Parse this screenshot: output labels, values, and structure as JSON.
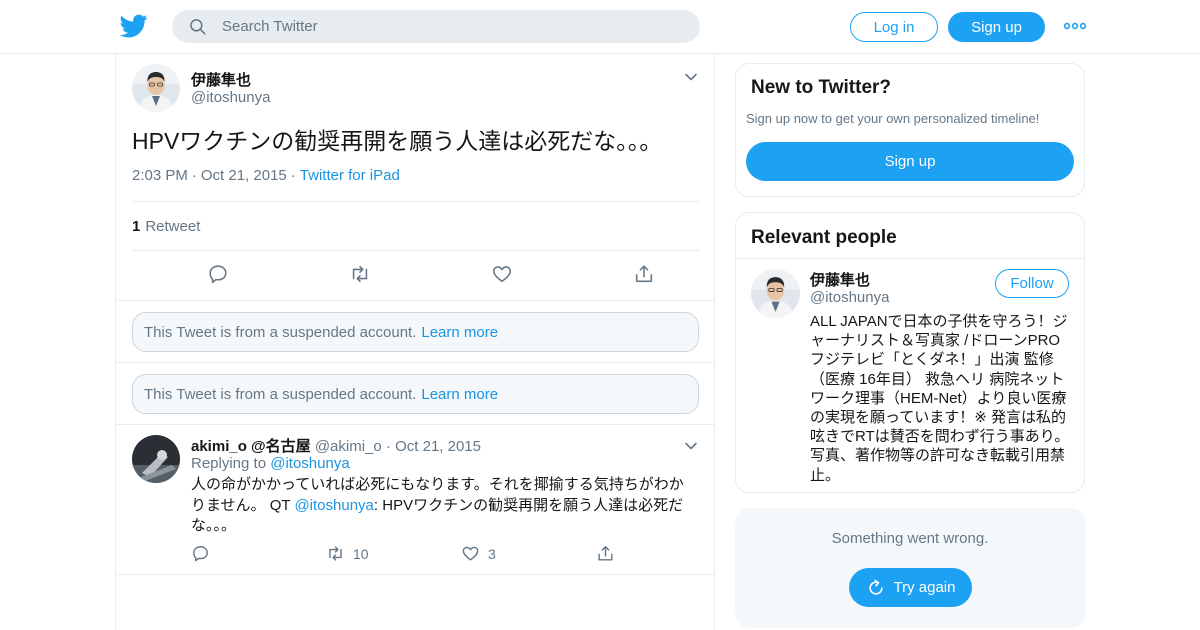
{
  "header": {
    "search_placeholder": "Search Twitter",
    "login_label": "Log in",
    "signup_label": "Sign up"
  },
  "tweet": {
    "author_name": "伊藤隼也",
    "author_handle": "@itoshunya",
    "text": "HPVワクチンの勧奨再開を願う人達は必死だな。。。",
    "time": "2:03 PM",
    "date": "Oct 21, 2015",
    "source": "Twitter for iPad",
    "retweet_count": "1",
    "retweet_label": "Retweet"
  },
  "suspended": [
    {
      "text": "This Tweet is from a suspended account.",
      "link": "Learn more"
    },
    {
      "text": "This Tweet is from a suspended account.",
      "link": "Learn more"
    }
  ],
  "reply": {
    "author_name": "akimi_o @名古屋",
    "author_handle": "@akimi_o",
    "date": "Oct 21, 2015",
    "replying_prefix": "Replying to",
    "replying_handle": "@itoshunya",
    "text_part1": "人の命がかかっていれば必死にもなります。それを揶揄する気持ちがわかりません。 QT ",
    "text_mention": "@itoshunya",
    "text_part2": ": HPVワクチンの勧奨再開を願う人達は必死だな。。。",
    "retweets": "10",
    "likes": "3"
  },
  "sidebar": {
    "new_title": "New to Twitter?",
    "new_subtitle": "Sign up now to get your own personalized timeline!",
    "new_button": "Sign up",
    "relevant_title": "Relevant people",
    "person": {
      "name": "伊藤隼也",
      "handle": "@itoshunya",
      "follow_label": "Follow",
      "bio": "ALL JAPANで日本の子供を守ろう！ジャーナリスト＆写真家 /ドローンPRO フジテレビ「とくダネ！」出演 監修（医療 16年目） 救急ヘリ 病院ネットワーク理事（HEM-Net）より良い医療の実現を願っています！※ 発言は私的呟きでRTは賛否を問わず行う事あり。写真、著作物等の許可なき転載引用禁止。"
    },
    "error_text": "Something went wrong.",
    "try_again": "Try again"
  },
  "colors": {
    "brand": "#1da1f2",
    "link": "#1b95e0",
    "muted": "#657786",
    "border": "#e6ecf0"
  }
}
